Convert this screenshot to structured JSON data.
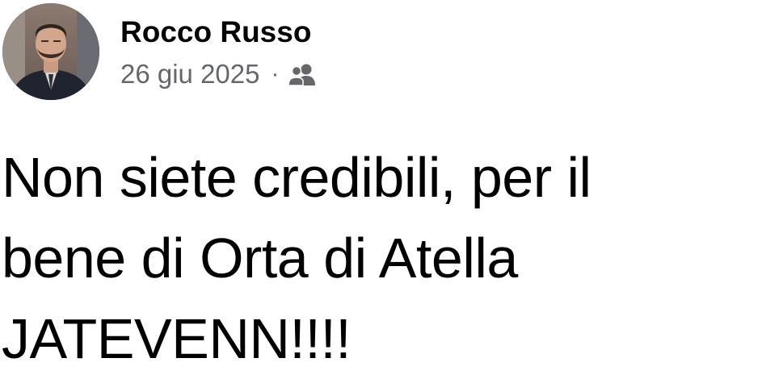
{
  "post": {
    "author": {
      "name": "Rocco Russo",
      "avatar": "profile-photo"
    },
    "date": "26 giu 2025",
    "separator": "·",
    "audience_icon": "friends-icon",
    "text": "Non siete credibili, per il\nbene di Orta di Atella\nJATEVENN!!!!"
  },
  "colors": {
    "name": "#050505",
    "meta": "#65676b",
    "body_text": "#000000",
    "background": "#ffffff"
  }
}
